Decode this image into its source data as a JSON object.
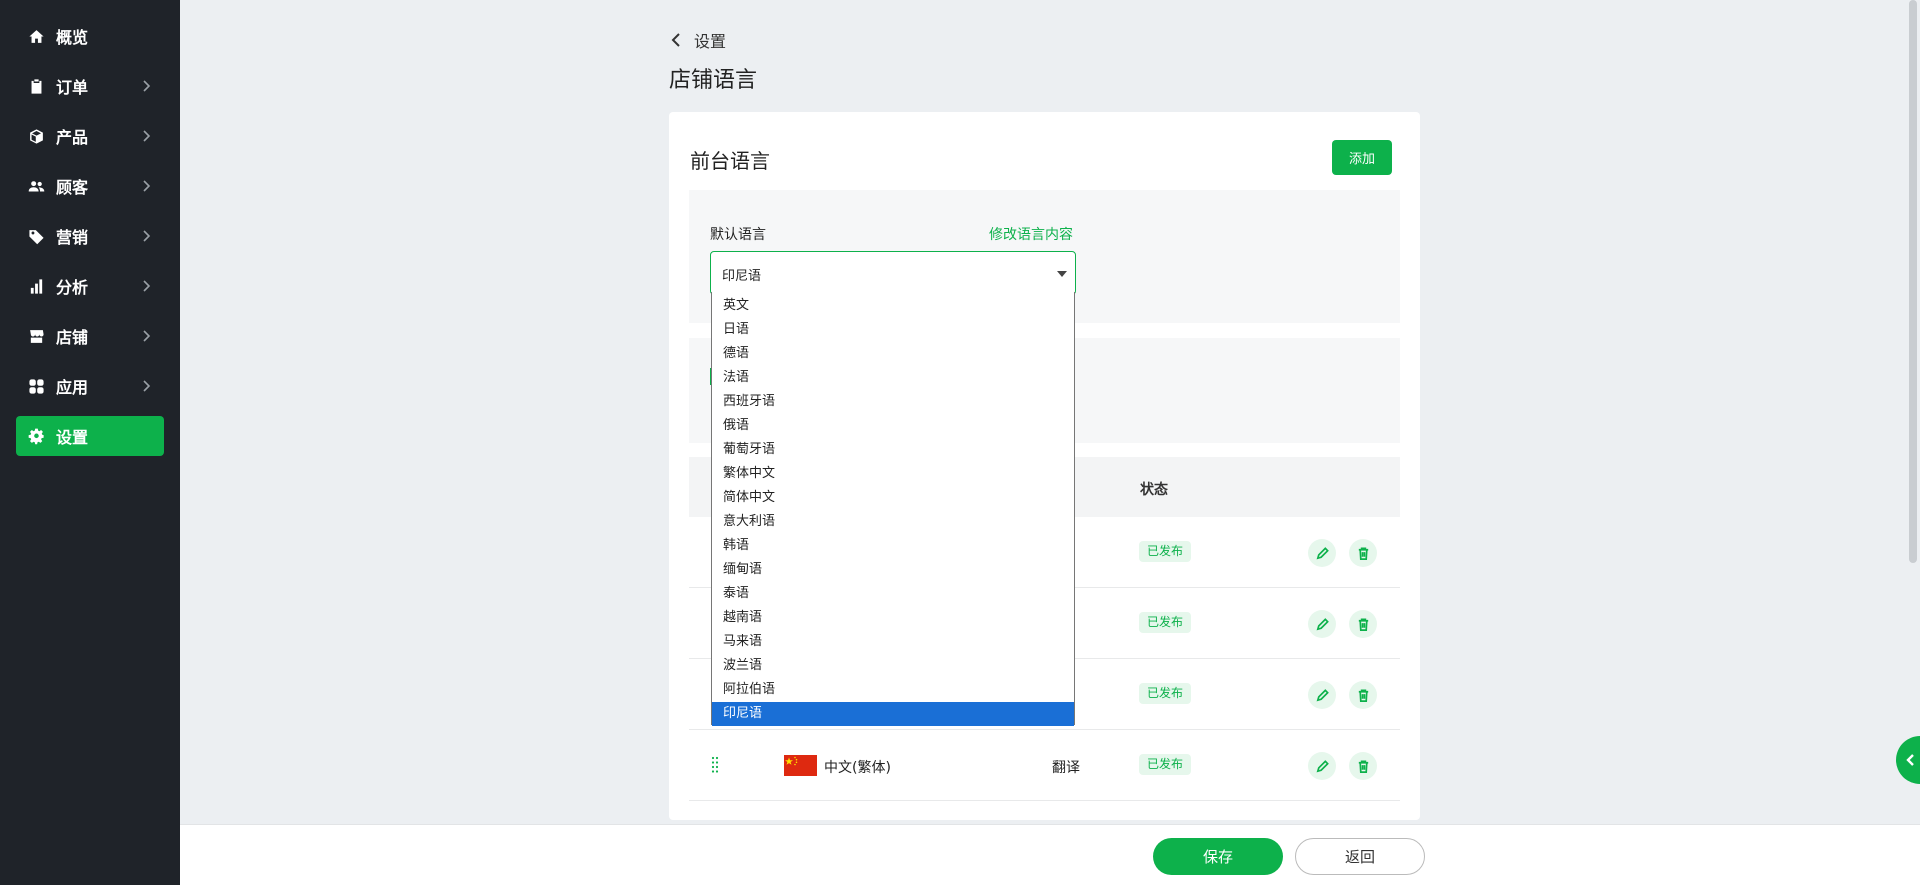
{
  "sidebar": {
    "items": [
      {
        "label": "概览",
        "icon": "home-icon"
      },
      {
        "label": "订单",
        "icon": "clipboard-icon"
      },
      {
        "label": "产品",
        "icon": "box-icon"
      },
      {
        "label": "顾客",
        "icon": "users-icon"
      },
      {
        "label": "营销",
        "icon": "tag-icon"
      },
      {
        "label": "分析",
        "icon": "bar-chart-icon"
      },
      {
        "label": "店铺",
        "icon": "store-icon"
      },
      {
        "label": "应用",
        "icon": "apps-icon"
      },
      {
        "label": "设置",
        "icon": "gear-icon",
        "active": true
      }
    ]
  },
  "header": {
    "back_label": "设置",
    "title": "店铺语言"
  },
  "card": {
    "title": "前台语言",
    "add_label": "添加",
    "default_label": "默认语言",
    "modify_link": "修改语言内容",
    "select_value": "印尼语"
  },
  "dropdown": {
    "options": [
      "英文",
      "日语",
      "德语",
      "法语",
      "西班牙语",
      "俄语",
      "葡萄牙语",
      "繁体中文",
      "简体中文",
      "意大利语",
      "韩语",
      "缅甸语",
      "泰语",
      "越南语",
      "马来语",
      "波兰语",
      "阿拉伯语",
      "印尼语"
    ],
    "selected": "印尼语"
  },
  "table": {
    "status_header": "状态",
    "rows": [
      {
        "status": "已发布"
      },
      {
        "status": "已发布"
      },
      {
        "status": "已发布"
      },
      {
        "name": "中文(繁体)",
        "action": "翻译",
        "status": "已发布"
      }
    ]
  },
  "footer": {
    "save_label": "保存",
    "return_label": "返回"
  },
  "colors": {
    "accent": "#0db14b",
    "sidebar_bg": "#1f2329",
    "selected_option": "#1a6fd6"
  }
}
